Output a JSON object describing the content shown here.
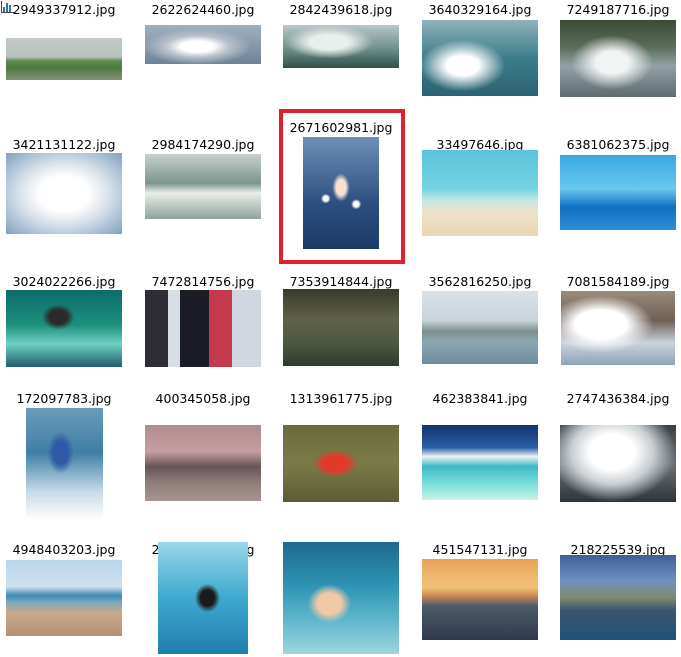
{
  "toolbar": {
    "icon": "bar-chart-icon"
  },
  "selection": {
    "selected_index": 7,
    "highlight_color": "#e0202e"
  },
  "images": [
    {
      "filename": "2949337912.jpg",
      "style": "t-wave-green"
    },
    {
      "filename": "2622624460.jpg",
      "style": "t-splash-grey"
    },
    {
      "filename": "2842439618.jpg",
      "style": "t-surf-tube"
    },
    {
      "filename": "3640329164.jpg",
      "style": "t-surf-blue"
    },
    {
      "filename": "7249187716.jpg",
      "style": "t-ski-dark"
    },
    {
      "filename": "3421131122.jpg",
      "style": "t-kayak-white"
    },
    {
      "filename": "2984174290.jpg",
      "style": "t-bodyboard"
    },
    {
      "filename": "2671602981.jpg",
      "style": "t-sparkle"
    },
    {
      "filename": "33497646.jpg",
      "style": "t-beach-yoga"
    },
    {
      "filename": "6381062375.jpg",
      "style": "t-swim-pool"
    },
    {
      "filename": "3024022266.jpg",
      "style": "t-surf-green"
    },
    {
      "filename": "7472814756.jpg",
      "style": "t-sailboats"
    },
    {
      "filename": "7353914844.jpg",
      "style": "t-kayak-race"
    },
    {
      "filename": "3562816250.jpg",
      "style": "t-yellow-kayak"
    },
    {
      "filename": "7081584189.jpg",
      "style": "t-kayak-foam"
    },
    {
      "filename": "172097783.jpg",
      "style": "t-wakeboard"
    },
    {
      "filename": "400345058.jpg",
      "style": "t-sunset-beach"
    },
    {
      "filename": "1313961775.jpg",
      "style": "t-floating"
    },
    {
      "filename": "462383841.jpg",
      "style": "t-tropical"
    },
    {
      "filename": "2747436384.jpg",
      "style": "t-big-wave"
    },
    {
      "filename": "4948403203.jpg",
      "style": "t-beach-post"
    },
    {
      "filename": "2782480767.jpg",
      "style": "t-underwater"
    },
    {
      "filename": "2596474836.jpg",
      "style": "t-swim-lesson"
    },
    {
      "filename": "451547131.jpg",
      "style": "t-sunset-surf"
    },
    {
      "filename": "218225539.jpg",
      "style": "t-lake-sail"
    }
  ]
}
